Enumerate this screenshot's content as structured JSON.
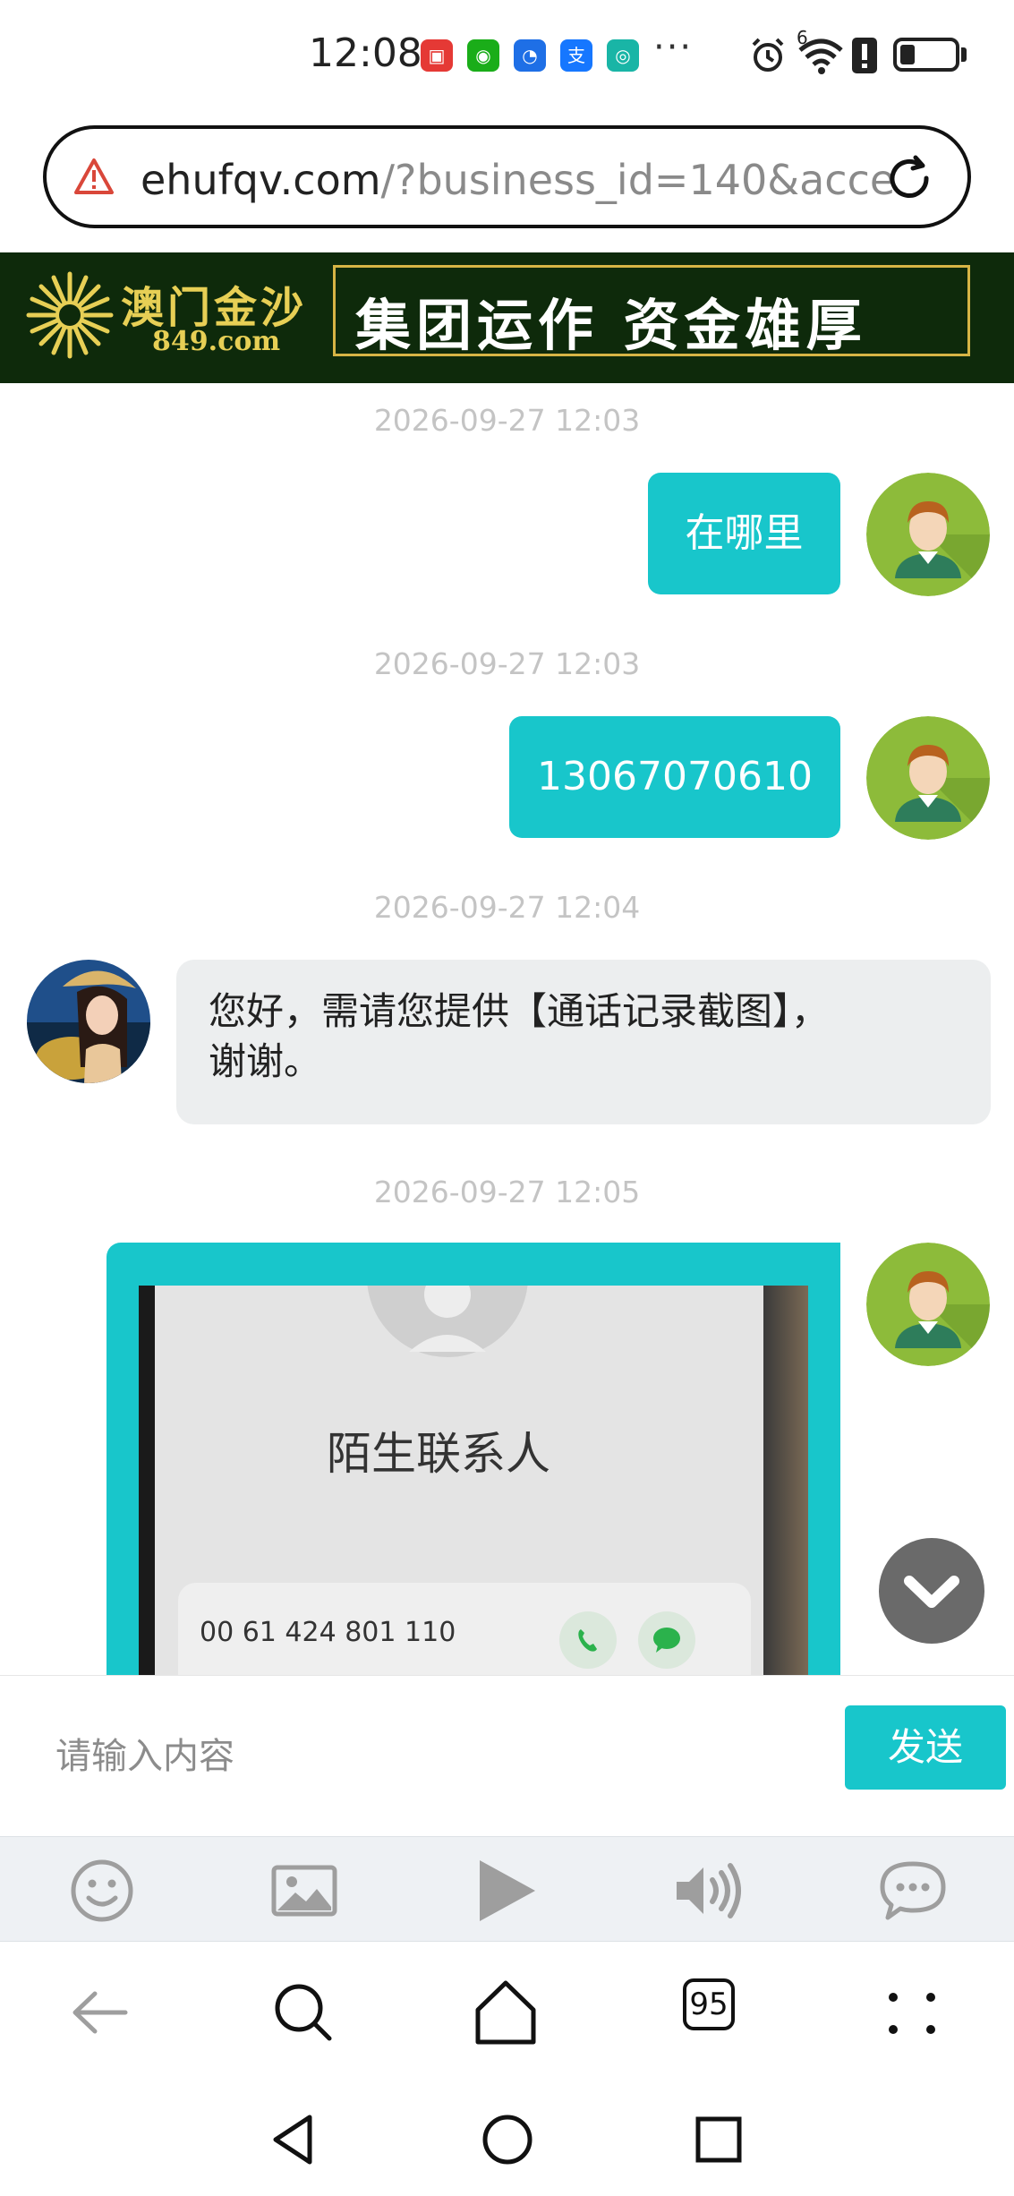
{
  "status_bar": {
    "time": "12:08",
    "app_icons": [
      {
        "name": "huawei-appgallery-icon",
        "color": "#e53935",
        "glyph": "▣"
      },
      {
        "name": "wechat-icon",
        "color": "#1aad19",
        "glyph": "◉"
      },
      {
        "name": "lightbulb-app-icon",
        "color": "#1e6fe6",
        "glyph": "◔"
      },
      {
        "name": "alipay-icon",
        "color": "#1677ff",
        "glyph": "支"
      },
      {
        "name": "owl-app-icon",
        "color": "#19b5a6",
        "glyph": "◎"
      }
    ],
    "more": "···",
    "network_label": "6"
  },
  "url_bar": {
    "domain": "ehufqv.com",
    "path": "/?business_id=140&acce"
  },
  "banner": {
    "brand": "澳门金沙",
    "domain": "849.com",
    "slogan": "集团运作  资金雄厚",
    "colors": {
      "background": "#0e2a0b",
      "gold": "#e7cf55"
    }
  },
  "chat": {
    "messages": [
      {
        "timestamp": "2026-09-27 12:03",
        "direction": "sent",
        "text": "在哪里"
      },
      {
        "timestamp": "2026-09-27 12:03",
        "direction": "sent",
        "text": "13067070610"
      },
      {
        "timestamp": "2026-09-27 12:04",
        "direction": "received",
        "line1": "您好，需请您提供【通话记录截图】，",
        "line2": "谢谢。"
      },
      {
        "timestamp": "2026-09-27 12:05",
        "direction": "sent",
        "type": "image",
        "image_contact": "陌生联系人",
        "image_number": "00 61 424 801 110"
      }
    ],
    "accent_color": "#18c6cb"
  },
  "input": {
    "placeholder": "请输入内容",
    "send_label": "发送"
  },
  "toolbar": {
    "items": [
      "emoji-icon",
      "image-icon",
      "video-play-icon",
      "voice-icon",
      "chat-bubble-icon"
    ]
  },
  "browser_nav": {
    "tab_count": "95"
  }
}
